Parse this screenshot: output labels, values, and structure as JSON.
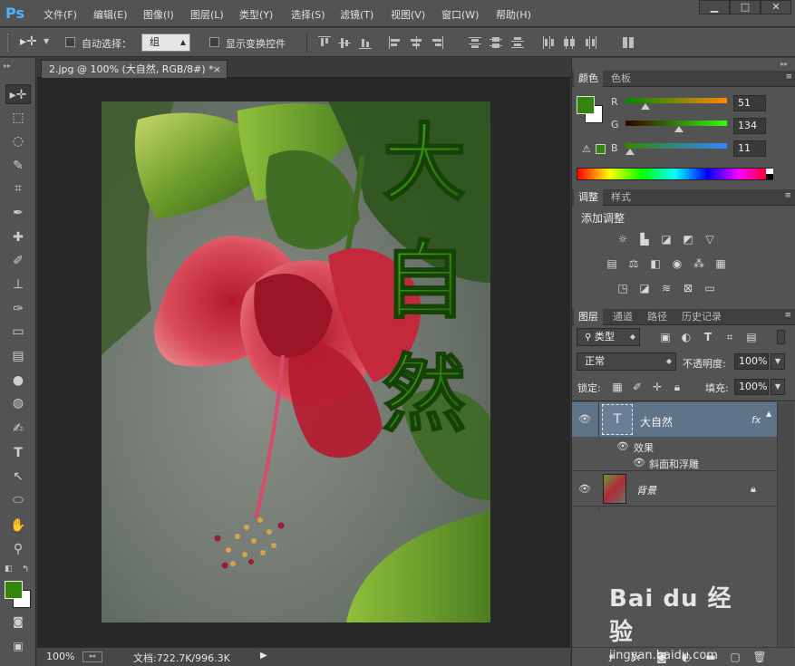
{
  "menubar": {
    "logo": "Ps",
    "items": [
      "文件(F)",
      "编辑(E)",
      "图像(I)",
      "图层(L)",
      "类型(Y)",
      "选择(S)",
      "滤镜(T)",
      "视图(V)",
      "窗口(W)",
      "帮助(H)"
    ],
    "win_min": "▁",
    "win_max": "□",
    "win_close": "✕"
  },
  "options": {
    "auto_select_label": "自动选择：",
    "auto_select_value": "组",
    "show_transform_label": "显示变换控件"
  },
  "document": {
    "tab_title": "2.jpg @ 100% (大自然, RGB/8#) *",
    "tab_close": "×",
    "canvas_text": [
      "大",
      "自",
      "然"
    ]
  },
  "status": {
    "zoom": "100%",
    "doc_info": "文档:722.7K/996.3K"
  },
  "color_panel": {
    "tabs": [
      "颜色",
      "色板"
    ],
    "r_label": "R",
    "g_label": "G",
    "b_label": "B",
    "r_value": "51",
    "g_value": "134",
    "b_value": "11",
    "r_fraction": 0.2,
    "g_fraction": 0.525,
    "b_fraction": 0.043,
    "fg_color": "#33860b",
    "bg_color": "#ffffff"
  },
  "adjust_panel": {
    "tabs": [
      "调整",
      "样式"
    ],
    "title": "添加调整"
  },
  "layers_panel": {
    "tabs": [
      "图层",
      "通道",
      "路径",
      "历史记录"
    ],
    "filter_kind": "类型",
    "blend_mode": "正常",
    "opacity_label": "不透明度:",
    "opacity_value": "100%",
    "lock_label": "锁定:",
    "fill_label": "填充:",
    "fill_value": "100%",
    "layers": [
      {
        "name": "大自然",
        "fx": "fx",
        "effects_label": "效果",
        "effect": "斜面和浮雕"
      },
      {
        "name": "背景"
      }
    ]
  },
  "watermark": {
    "brand": "Bai du 经验",
    "url": "jingyan.baidu.com"
  }
}
